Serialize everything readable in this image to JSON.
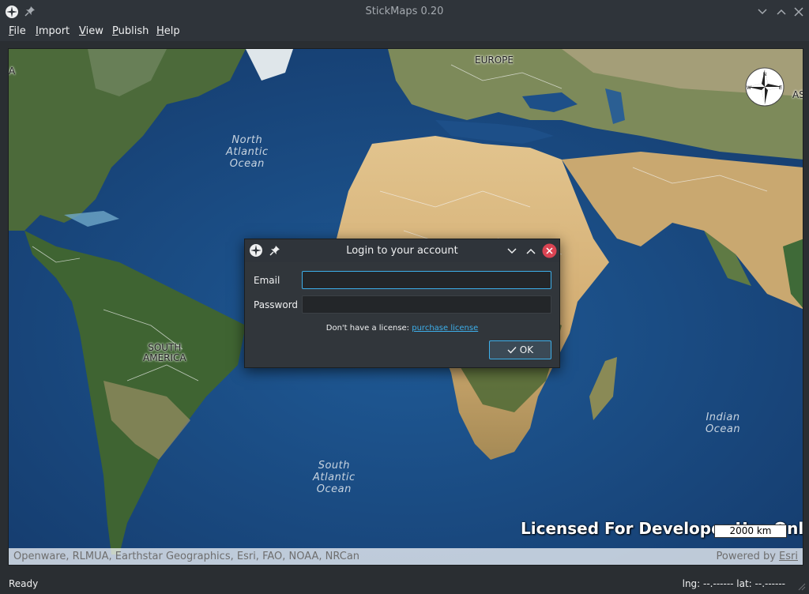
{
  "window": {
    "title": "StickMaps 0.20"
  },
  "menu": [
    {
      "accel": "F",
      "rest": "ile"
    },
    {
      "accel": "I",
      "rest": "mport"
    },
    {
      "accel": "V",
      "rest": "iew"
    },
    {
      "accel": "P",
      "rest": "ublish"
    },
    {
      "accel": "H",
      "rest": "elp"
    }
  ],
  "map": {
    "labels": {
      "europe": "EUROPE",
      "south_america": "SOUTH\nAMERICA",
      "north_atlantic": "North\nAtlantic\nOcean",
      "south_atlantic": "South\nAtlantic\nOcean",
      "indian_ocean": "Indian\nOcean",
      "asia_fragment": "AS",
      "west_edge_fragment": "A"
    },
    "attribution": "Openware, RLMUA, Earthstar Geographics, Esri, FAO, NOAA, NRCan",
    "powered_by": "Powered by",
    "powered_by_link": "Esri",
    "watermark": "Licensed For Developer Use Only",
    "scale": "2000 km",
    "compass": {
      "n": "N",
      "w": "W",
      "e": "E"
    }
  },
  "dialog": {
    "title": "Login to your account",
    "email_label": "Email",
    "email_value": "",
    "password_label": "Password",
    "password_value": "",
    "license_text": "Don't have a license:",
    "license_link": "purchase license",
    "ok_label": "OK"
  },
  "status": {
    "left": "Ready",
    "coords": "lng: --.------ lat: --.------"
  },
  "colors": {
    "accent": "#3daee9",
    "close": "#da4453",
    "window_bg": "#31363b"
  }
}
